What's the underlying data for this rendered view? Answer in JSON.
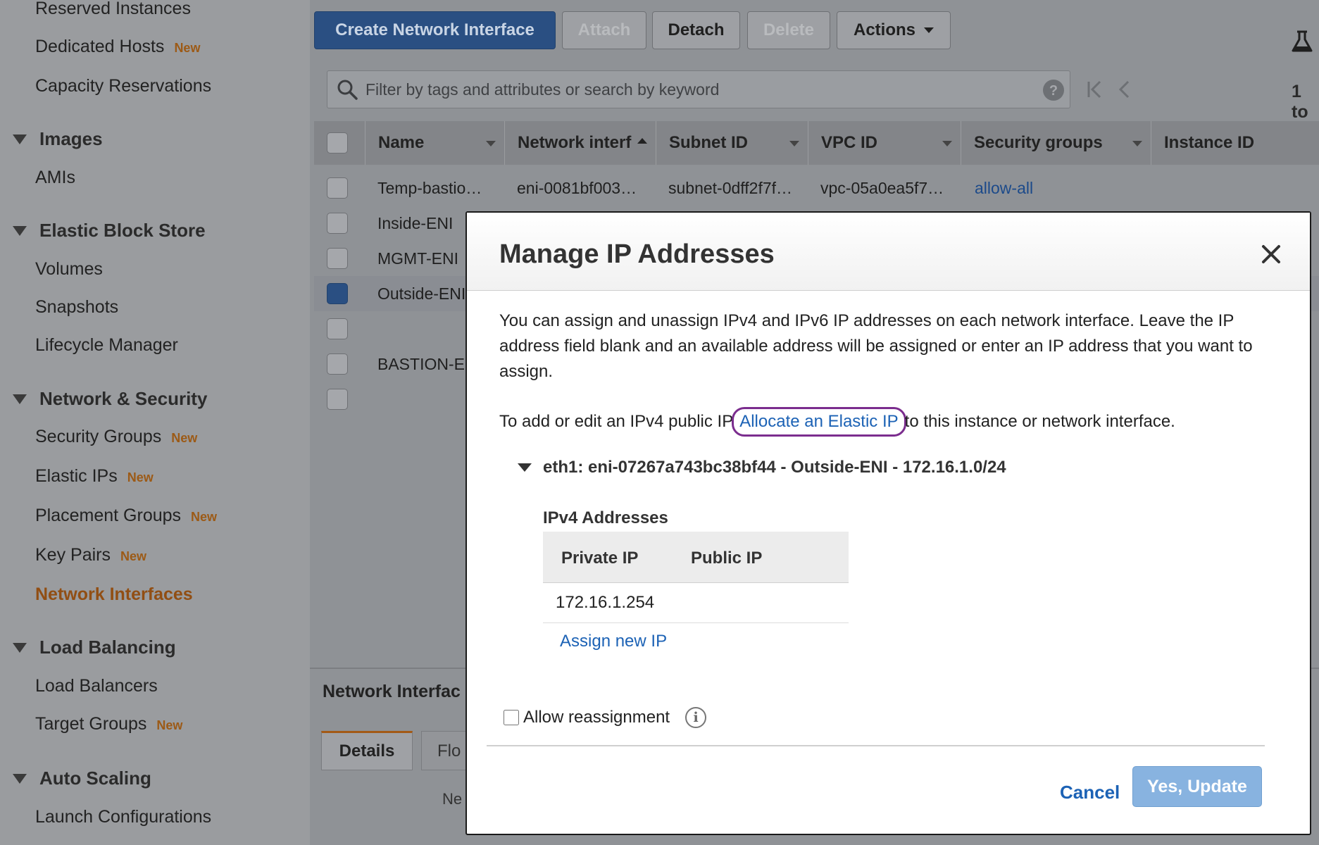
{
  "sidebar": {
    "top_items": [
      {
        "label": "Reserved Instances",
        "new": ""
      },
      {
        "label": "Dedicated Hosts",
        "new": "New"
      },
      {
        "label": "Capacity Reservations",
        "new": ""
      }
    ],
    "sections": [
      {
        "title": "Images",
        "items": [
          {
            "label": "AMIs",
            "new": ""
          }
        ]
      },
      {
        "title": "Elastic Block Store",
        "items": [
          {
            "label": "Volumes",
            "new": ""
          },
          {
            "label": "Snapshots",
            "new": ""
          },
          {
            "label": "Lifecycle Manager",
            "new": ""
          }
        ]
      },
      {
        "title": "Network & Security",
        "items": [
          {
            "label": "Security Groups",
            "new": "New"
          },
          {
            "label": "Elastic IPs",
            "new": "New"
          },
          {
            "label": "Placement Groups",
            "new": "New"
          },
          {
            "label": "Key Pairs",
            "new": "New"
          },
          {
            "label": "Network Interfaces",
            "new": ""
          }
        ]
      },
      {
        "title": "Load Balancing",
        "items": [
          {
            "label": "Load Balancers",
            "new": ""
          },
          {
            "label": "Target Groups",
            "new": "New"
          }
        ]
      },
      {
        "title": "Auto Scaling",
        "items": [
          {
            "label": "Launch Configurations",
            "new": ""
          }
        ]
      }
    ]
  },
  "toolbar": {
    "create": "Create Network Interface",
    "attach": "Attach",
    "detach": "Detach",
    "delete": "Delete",
    "actions": "Actions"
  },
  "search": {
    "placeholder": "Filter by tags and attributes or search by keyword"
  },
  "pager": {
    "text": "1 to"
  },
  "table": {
    "headers": [
      "Name",
      "Network interf",
      "Subnet ID",
      "VPC ID",
      "Security groups",
      "Instance ID"
    ],
    "rows": [
      {
        "name": "Temp-bastio…",
        "eni": "eni-0081bf003…",
        "subnet": "subnet-0dff2f7f…",
        "vpc": "vpc-05a0ea5f7…",
        "sg": "allow-all",
        "selected": false
      },
      {
        "name": "Inside-ENI",
        "selected": false
      },
      {
        "name": "MGMT-ENI",
        "selected": false
      },
      {
        "name": "Outside-ENI",
        "selected": true
      },
      {
        "name": "",
        "selected": false
      },
      {
        "name": "BASTION-E",
        "selected": false
      },
      {
        "name": "",
        "selected": false
      }
    ]
  },
  "bottom_panel": {
    "title": "Network Interfac",
    "tab_details": "Details",
    "tab_flow": "Flo",
    "fragment": "Ne"
  },
  "modal": {
    "title": "Manage IP Addresses",
    "description": "You can assign and unassign IPv4 and IPv6 IP addresses on each network interface. Leave the IP address field blank and an available address will be assigned or enter an IP address that you want to assign.",
    "public_ip_prefix": "To add or edit an IPv4 public IP",
    "public_ip_link": "Allocate an Elastic IP",
    "public_ip_suffix": "to this instance or network interface.",
    "eni_title": "eth1: eni-07267a743bc38bf44 - Outside-ENI - 172.16.1.0/24",
    "ipv4_title": "IPv4 Addresses",
    "ip_headers": [
      "Private IP",
      "Public IP"
    ],
    "ip_rows": [
      {
        "private": "172.16.1.254",
        "public": ""
      }
    ],
    "assign_new": "Assign new IP",
    "allow_reassignment": "Allow reassignment",
    "cancel": "Cancel",
    "update": "Yes, Update"
  }
}
